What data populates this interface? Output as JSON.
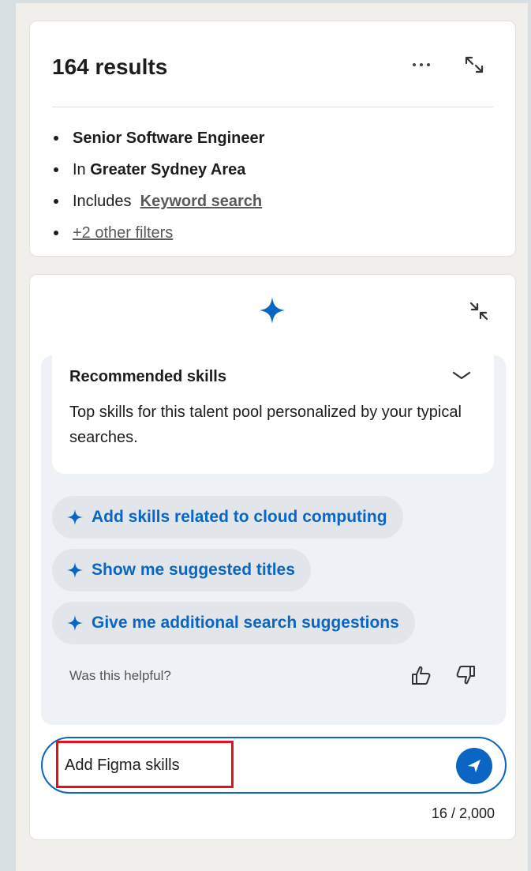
{
  "results": {
    "title": "164 results",
    "filters": {
      "title_filter": "Senior Software Engineer",
      "location_prefix": "In",
      "location_value": "Greater Sydney Area",
      "includes_prefix": "Includes",
      "includes_link": "Keyword search",
      "other_filters_link": "+2 other filters"
    }
  },
  "assistant": {
    "recommended": {
      "title": "Recommended skills",
      "description": "Top skills for this talent pool personalized by your typical searches."
    },
    "suggestions": [
      "Add skills related to cloud computing",
      "Show me suggested titles",
      "Give me additional search suggestions"
    ],
    "feedback_prompt": "Was this helpful?",
    "input_value": "Add Figma skills",
    "char_counter": "16 / 2,000"
  },
  "icons": {
    "more": "more-horizontal-icon",
    "expand": "expand-icon",
    "sparkle": "sparkle-icon",
    "collapse": "collapse-icon",
    "chevron": "chevron-down-icon",
    "thumbs_up": "thumbs-up-icon",
    "thumbs_down": "thumbs-down-icon",
    "send": "send-icon"
  },
  "colors": {
    "accent": "#0a66c2",
    "highlight": "#e0131d"
  }
}
